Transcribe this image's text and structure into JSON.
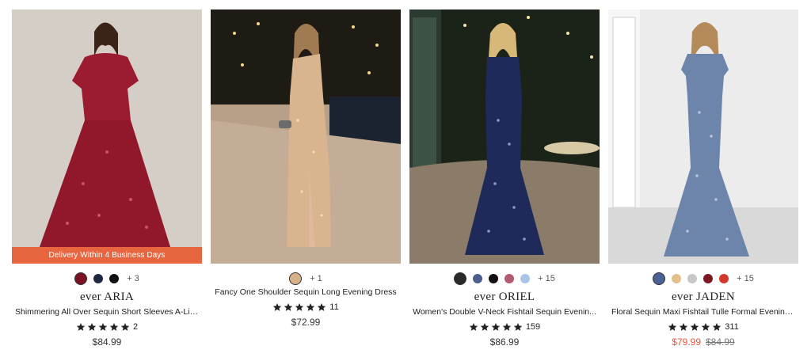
{
  "products": [
    {
      "banner": "Delivery Within 4 Business Days",
      "swatches": [
        "#7a1224",
        "#1e2a44",
        "#111111"
      ],
      "more_colors": "+ 3",
      "brand": "ever ARIA",
      "title": "Shimmering All Over Sequin Short Sleeves A-Lin...",
      "rating_count": "2",
      "price": "$84.99",
      "dress_color": "#9b1b30",
      "bg_color": "#d9d2cc"
    },
    {
      "swatches": [
        "#d9b08c"
      ],
      "more_colors": "+ 1",
      "brand": "",
      "title": "Fancy One Shoulder Sequin Long Evening Dress",
      "rating_count": "11",
      "price": "$72.99",
      "dress_color": "#d8b48f",
      "bg_color": "#3a2f22"
    },
    {
      "swatches": [
        "#2a2a2a",
        "#4a5f8f",
        "#111111",
        "#b35a6e",
        "#a9c6e8"
      ],
      "more_colors": "+ 15",
      "brand": "ever ORIEL",
      "title": "Women's Double V-Neck Fishtail Sequin Evenin...",
      "rating_count": "159",
      "price": "$86.99",
      "dress_color": "#1f2a5a",
      "bg_color": "#1f2a1a"
    },
    {
      "swatches": [
        "#4a6294",
        "#e3bf8e",
        "#c7c7c7",
        "#7a1a22",
        "#d0392b"
      ],
      "more_colors": "+ 15",
      "brand": "ever JADEN",
      "title": "Floral Sequin Maxi Fishtail Tulle Formal Evening...",
      "rating_count": "311",
      "sale_price": "$79.99",
      "original_price": "$84.99",
      "dress_color": "#6d84ab",
      "bg_color": "#e8e8e8"
    }
  ]
}
